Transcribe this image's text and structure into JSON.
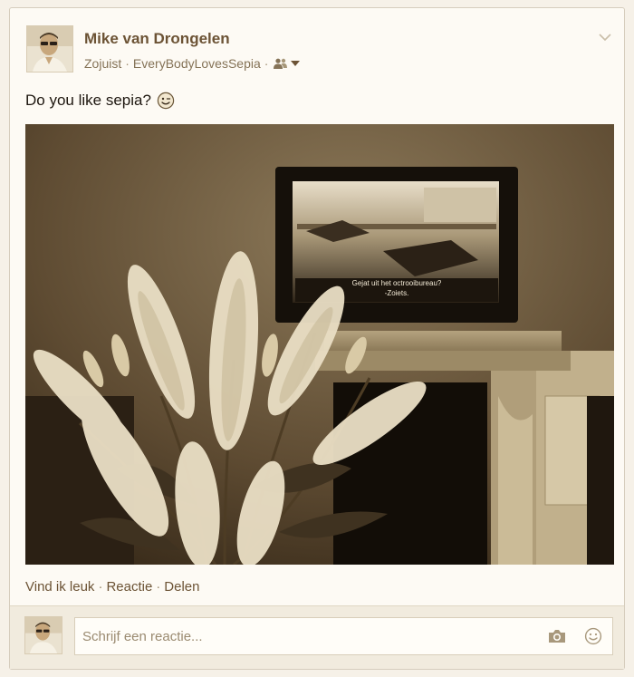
{
  "post": {
    "author": "Mike van Drongelen",
    "time": "Zojuist",
    "group": "EveryBodyLovesSepia",
    "separator": "·",
    "audience_icon": "friends-icon",
    "menu_icon": "chevron-down-icon",
    "text": "Do you like sepia?",
    "emoji_icon": "smiley-wink-icon",
    "photo_subtitles": [
      "Gejat uit het octrooibureau?",
      "-Zoiets."
    ]
  },
  "actions": {
    "like": "Vind ik leuk",
    "comment": "Reactie",
    "share": "Delen",
    "separator": "·"
  },
  "comment_box": {
    "placeholder": "Schrijf een reactie...",
    "camera_icon": "camera-icon",
    "emoji_icon": "smiley-icon"
  },
  "colors": {
    "author": "#6c5335",
    "meta": "#857357",
    "card_bg": "#fdfaf4",
    "page_bg": "#f6f1e8"
  }
}
